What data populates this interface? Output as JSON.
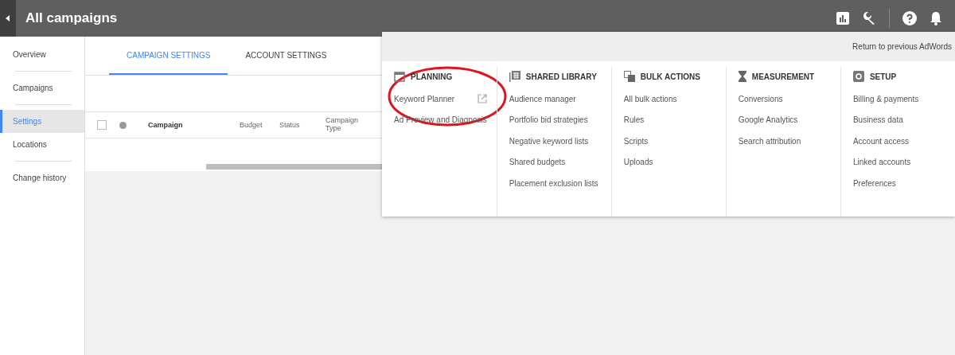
{
  "header": {
    "title": "All campaigns"
  },
  "sidebar": {
    "items": [
      {
        "label": "Overview",
        "selected": false
      },
      {
        "label": "Campaigns",
        "selected": false
      },
      {
        "label": "Settings",
        "selected": true
      },
      {
        "label": "Locations",
        "selected": false
      },
      {
        "label": "Change history",
        "selected": false
      }
    ]
  },
  "tabs": [
    {
      "label": "CAMPAIGN SETTINGS",
      "selected": true
    },
    {
      "label": "ACCOUNT SETTINGS",
      "selected": false
    }
  ],
  "table": {
    "select_all": {
      "checked": false
    },
    "columns": [
      "Campaign",
      "Budget",
      "Status",
      "Campaign Type"
    ]
  },
  "tools_menu": {
    "return_link": "Return to previous AdWords",
    "sections": [
      {
        "kind": "planning",
        "title": "PLANNING",
        "items": [
          {
            "label": "Keyword Planner",
            "external": true
          },
          {
            "label": "Ad Preview and Diagnosis",
            "external": false
          }
        ]
      },
      {
        "kind": "library",
        "title": "SHARED LIBRARY",
        "items": [
          {
            "label": "Audience manager",
            "external": false
          },
          {
            "label": "Portfolio bid strategies",
            "external": false
          },
          {
            "label": "Negative keyword lists",
            "external": false
          },
          {
            "label": "Shared budgets",
            "external": false
          },
          {
            "label": "Placement exclusion lists",
            "external": false
          }
        ]
      },
      {
        "kind": "bulk",
        "title": "BULK ACTIONS",
        "items": [
          {
            "label": "All bulk actions",
            "external": false
          },
          {
            "label": "Rules",
            "external": false
          },
          {
            "label": "Scripts",
            "external": false
          },
          {
            "label": "Uploads",
            "external": false
          }
        ]
      },
      {
        "kind": "measurement",
        "title": "MEASUREMENT",
        "items": [
          {
            "label": "Conversions",
            "external": false
          },
          {
            "label": "Google Analytics",
            "external": false
          },
          {
            "label": "Search attribution",
            "external": false
          }
        ]
      },
      {
        "kind": "setup",
        "title": "SETUP",
        "items": [
          {
            "label": "Billing & payments",
            "external": false
          },
          {
            "label": "Business data",
            "external": false
          },
          {
            "label": "Account access",
            "external": false
          },
          {
            "label": "Linked accounts",
            "external": false
          },
          {
            "label": "Preferences",
            "external": false
          }
        ]
      }
    ]
  }
}
